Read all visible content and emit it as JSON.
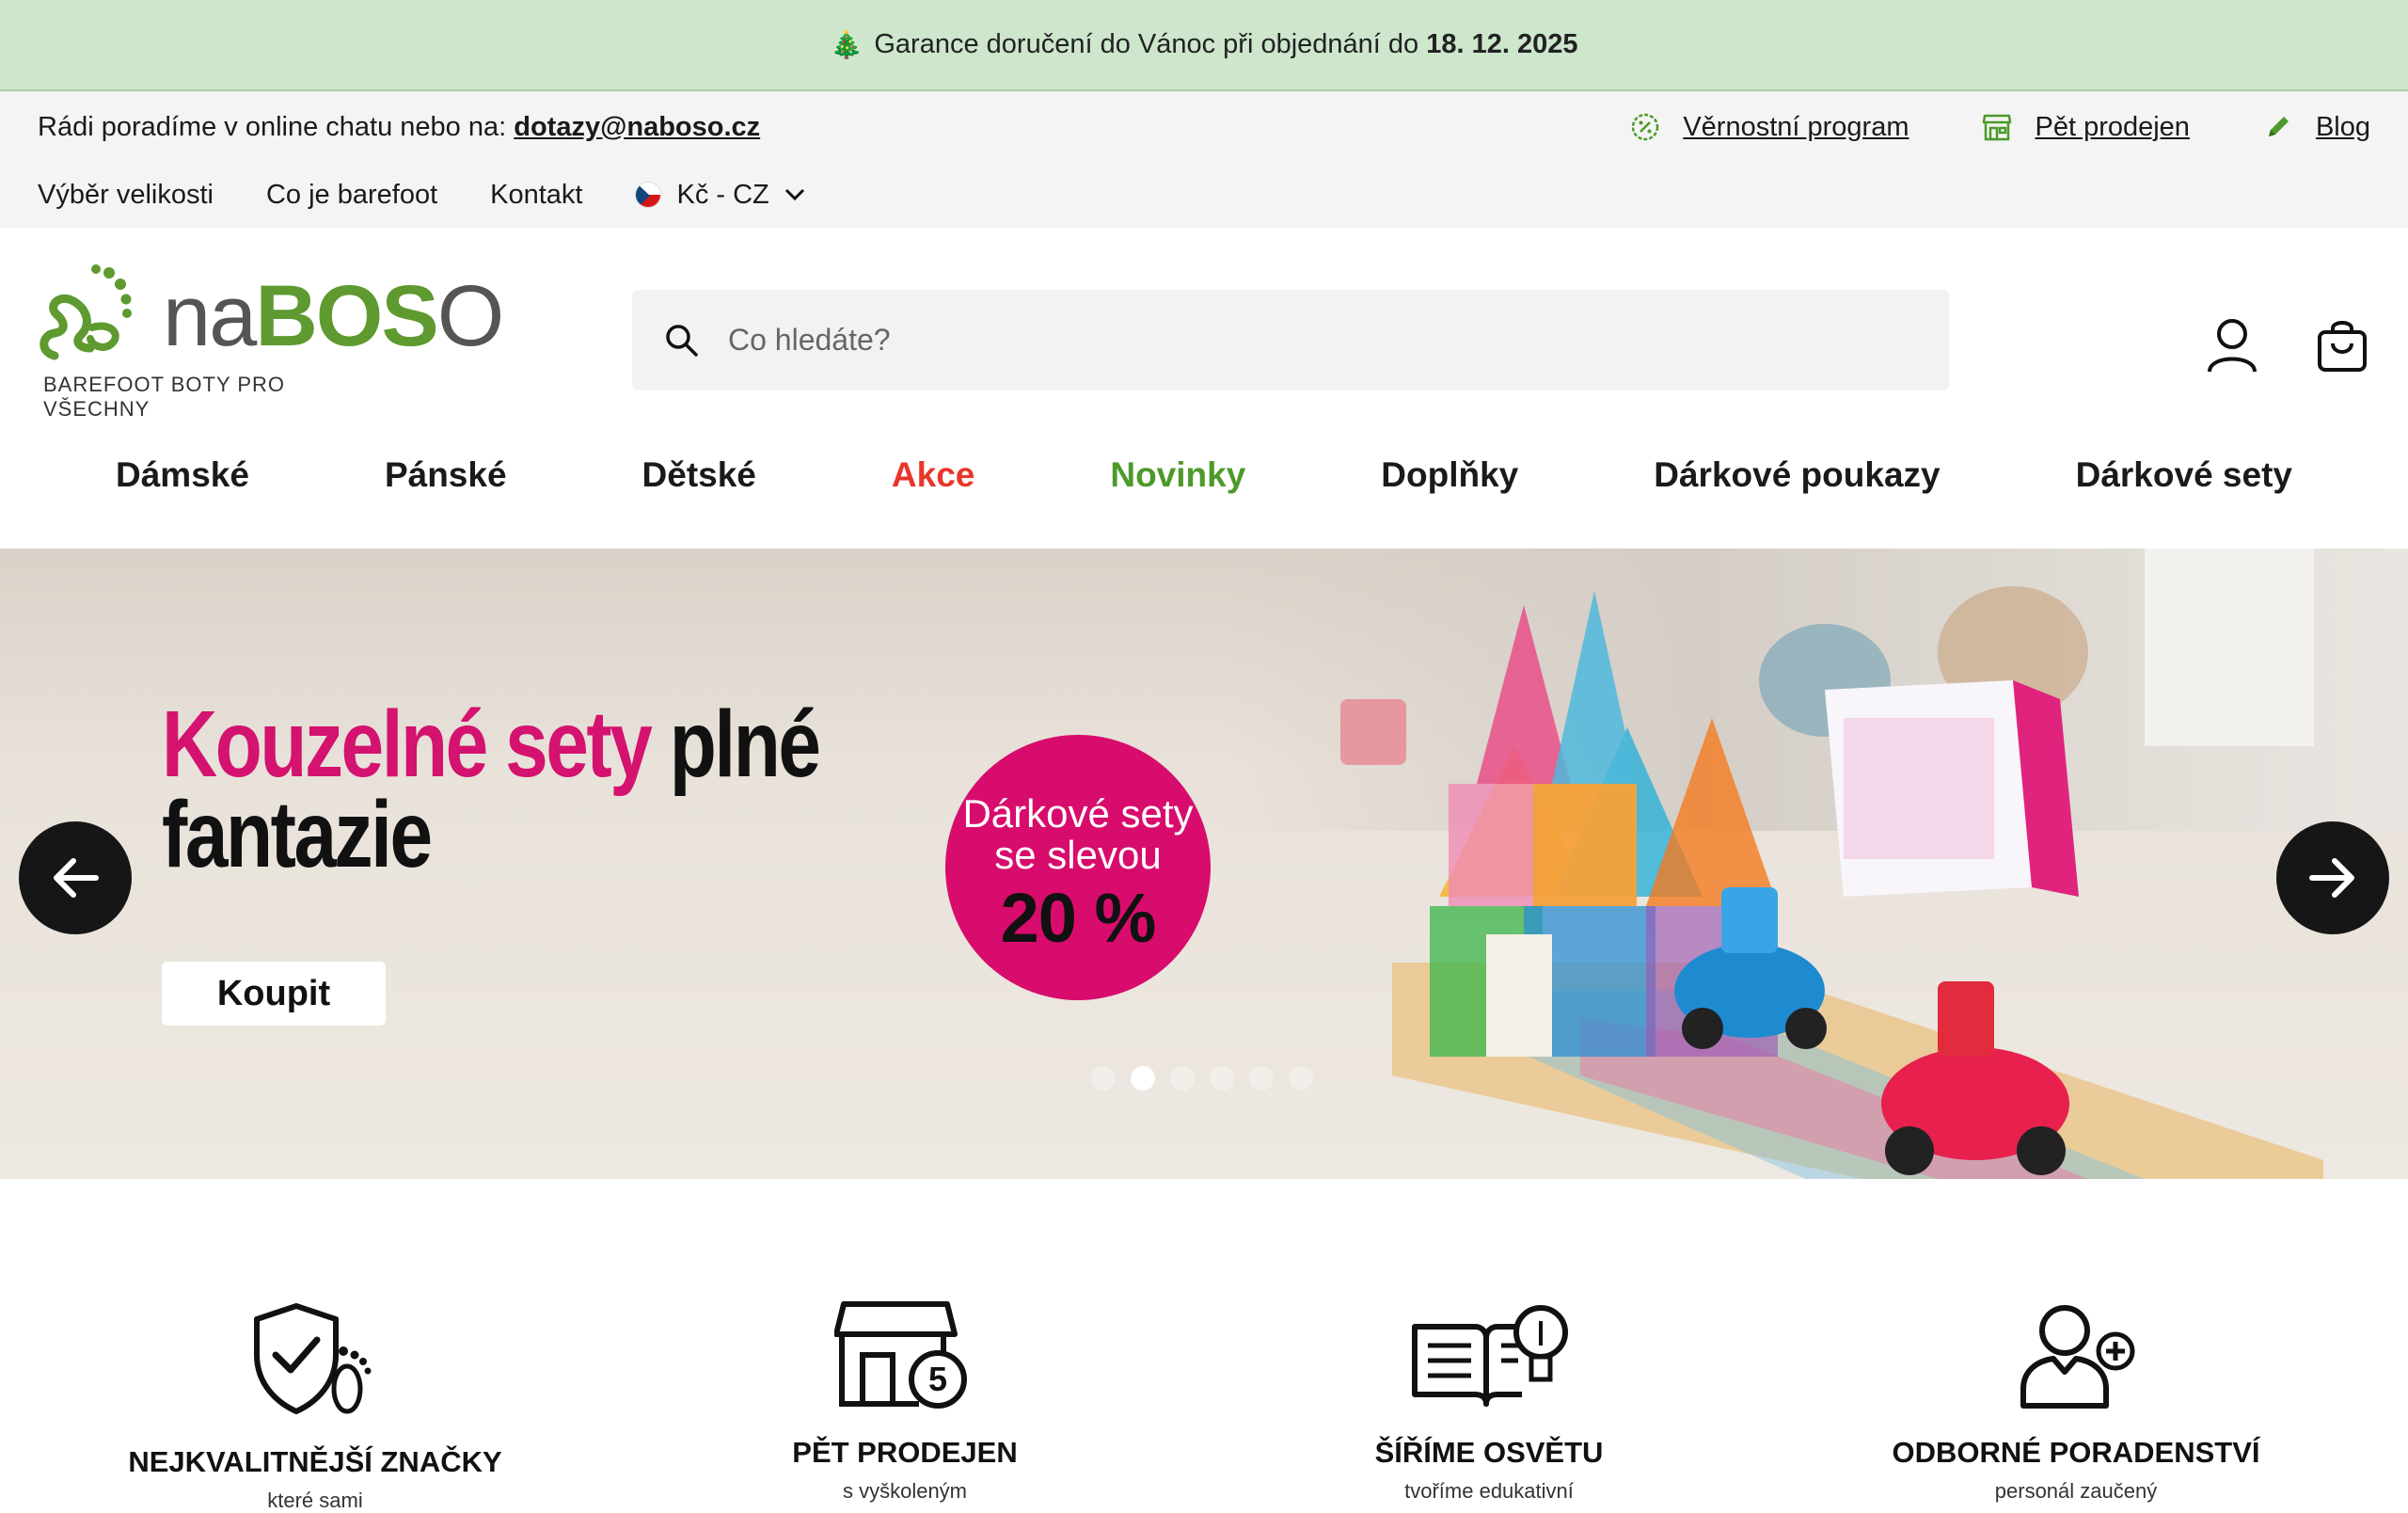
{
  "promo": {
    "icon": "christmas-tree-icon",
    "text": "Garance doručení do Vánoc při objednání do",
    "date": "18. 12. 2025"
  },
  "utility": {
    "chat_text": "Rádi poradíme v online chatu nebo na:",
    "email": "dotazy@naboso.cz",
    "links": [
      {
        "label": "Věrnostní program",
        "icon": "loyalty-percent-icon"
      },
      {
        "label": "Pět prodejen",
        "icon": "store-icon"
      },
      {
        "label": "Blog",
        "icon": "pencil-icon"
      }
    ],
    "nav": [
      "Výběr velikosti",
      "Co je barefoot",
      "Kontakt"
    ],
    "currency": "Kč - CZ"
  },
  "header": {
    "logo_na": "na",
    "logo_boso": "BOS",
    "logo_o": "O",
    "logo_tagline": "BAREFOOT BOTY PRO VŠECHNY",
    "search_placeholder": "Co hledáte?"
  },
  "main_nav": [
    {
      "label": "Dámské"
    },
    {
      "label": "Pánské"
    },
    {
      "label": "Dětské"
    },
    {
      "label": "Akce",
      "color": "#e8362a"
    },
    {
      "label": "Novinky",
      "color": "#4c9a2a"
    },
    {
      "label": "Doplňky"
    },
    {
      "label": "Dárkové poukazy"
    },
    {
      "label": "Dárkové sety"
    }
  ],
  "hero": {
    "headline_pink": "Kouzelné sety",
    "headline_dark_1": "plné",
    "headline_dark_2": "fantazie",
    "buy_label": "Koupit",
    "badge_line1": "Dárkové sety",
    "badge_line2": "se slevou",
    "badge_discount": "20 %",
    "slides_count": 6,
    "active_slide": 2,
    "accent_color": "#d4126f"
  },
  "features": [
    {
      "title": "NEJKVALITNĚJŠÍ ZNAČKY",
      "sub": "které sami",
      "icon": "shield-check-footprint-icon"
    },
    {
      "title": "PĚT PRODEJEN",
      "sub": "s vyškoleným",
      "icon": "store-five-icon"
    },
    {
      "title": "ŠÍŘÍME OSVĚTU",
      "sub": "tvoříme edukativní",
      "icon": "book-lightbulb-icon"
    },
    {
      "title": "ODBORNÉ PORADENSTVÍ",
      "sub": "personál zaučený",
      "icon": "person-plus-icon"
    }
  ]
}
